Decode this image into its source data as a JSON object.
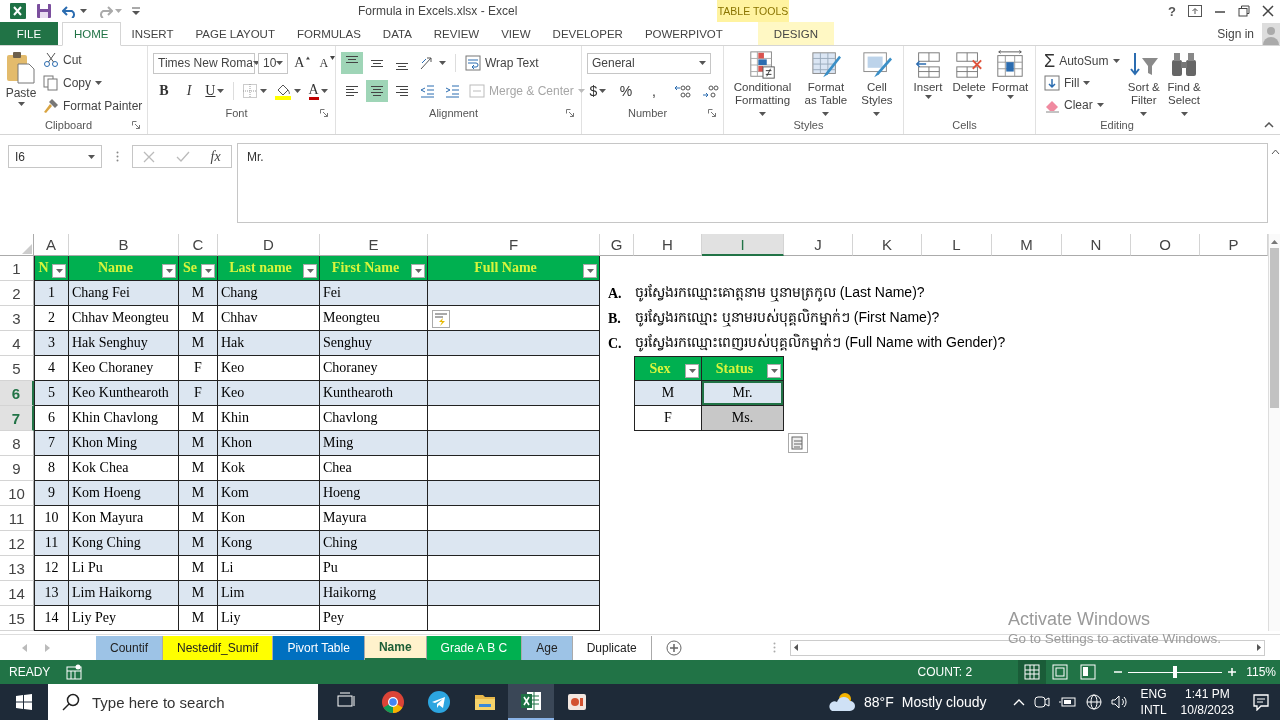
{
  "window": {
    "title": "Formula in Excels.xlsx - Excel",
    "context_label": "TABLE TOOLS",
    "help": "?",
    "sign_in": "Sign in"
  },
  "ribbon_tabs": [
    {
      "label": "FILE",
      "kind": "file",
      "selected": false
    },
    {
      "label": "HOME",
      "kind": "tab",
      "selected": true
    },
    {
      "label": "INSERT",
      "kind": "tab",
      "selected": false
    },
    {
      "label": "PAGE LAYOUT",
      "kind": "tab",
      "selected": false
    },
    {
      "label": "FORMULAS",
      "kind": "tab",
      "selected": false
    },
    {
      "label": "DATA",
      "kind": "tab",
      "selected": false
    },
    {
      "label": "REVIEW",
      "kind": "tab",
      "selected": false
    },
    {
      "label": "VIEW",
      "kind": "tab",
      "selected": false
    },
    {
      "label": "DEVELOPER",
      "kind": "tab",
      "selected": false
    },
    {
      "label": "POWERPIVOT",
      "kind": "tab",
      "selected": false
    },
    {
      "label": "DESIGN",
      "kind": "contextual",
      "selected": false
    }
  ],
  "ribbon": {
    "clipboard": {
      "label": "Clipboard",
      "paste": "Paste",
      "cut": "Cut",
      "copy": "Copy",
      "format_painter": "Format Painter"
    },
    "font": {
      "label": "Font",
      "name": "Times New Roma",
      "size": "10",
      "grow": "A",
      "shrink": "A",
      "bold": "B",
      "italic": "I",
      "underline": "U",
      "color_glyph": "A"
    },
    "alignment": {
      "label": "Alignment",
      "wrap_text": "Wrap Text",
      "merge_center": "Merge & Center",
      "merge_disabled": true,
      "buttons": [
        {
          "kind": "top",
          "selected": true
        },
        {
          "kind": "middle",
          "selected": false
        },
        {
          "kind": "bottom",
          "selected": false
        },
        {
          "kind": "left",
          "selected": false
        },
        {
          "kind": "center",
          "selected": true
        },
        {
          "kind": "right",
          "selected": false
        }
      ]
    },
    "number": {
      "label": "Number",
      "format": "General",
      "currency": "$",
      "percent": "%",
      "comma": ","
    },
    "styles": {
      "label": "Styles",
      "buttons": [
        {
          "kind": "conditional",
          "label": "Conditional Formatting"
        },
        {
          "kind": "table",
          "label": "Format as Table"
        },
        {
          "kind": "cell",
          "label": "Cell Styles"
        }
      ]
    },
    "cells": {
      "label": "Cells",
      "buttons": [
        {
          "kind": "insert",
          "label": "Insert"
        },
        {
          "kind": "delete",
          "label": "Delete"
        },
        {
          "kind": "format",
          "label": "Format"
        }
      ]
    },
    "editing": {
      "label": "Editing",
      "sum_glyph": "Σ",
      "autosum": "AutoSum",
      "fill": "Fill",
      "clear": "Clear",
      "sort_filter": "Sort & Filter",
      "find_select": "Find & Select"
    }
  },
  "formula_bar": {
    "name_box": "I6",
    "fx": "fx",
    "formula": "Mr."
  },
  "sheet": {
    "columns": [
      {
        "label": "A",
        "selected": false
      },
      {
        "label": "B",
        "selected": false
      },
      {
        "label": "C",
        "selected": false
      },
      {
        "label": "D",
        "selected": false
      },
      {
        "label": "E",
        "selected": false
      },
      {
        "label": "F",
        "selected": false
      },
      {
        "label": "G",
        "selected": false
      },
      {
        "label": "H",
        "selected": false
      },
      {
        "label": "I",
        "selected": true
      },
      {
        "label": "J",
        "selected": false
      },
      {
        "label": "K",
        "selected": false
      },
      {
        "label": "L",
        "selected": false
      },
      {
        "label": "M",
        "selected": false
      },
      {
        "label": "N",
        "selected": false
      },
      {
        "label": "O",
        "selected": false
      },
      {
        "label": "P",
        "selected": false
      }
    ],
    "rows": [
      {
        "label": "1",
        "selected": false
      },
      {
        "label": "2",
        "selected": false
      },
      {
        "label": "3",
        "selected": false
      },
      {
        "label": "4",
        "selected": false
      },
      {
        "label": "5",
        "selected": false
      },
      {
        "label": "6",
        "selected": true
      },
      {
        "label": "7",
        "selected": true
      },
      {
        "label": "8",
        "selected": false
      },
      {
        "label": "9",
        "selected": false
      },
      {
        "label": "10",
        "selected": false
      },
      {
        "label": "11",
        "selected": false
      },
      {
        "label": "12",
        "selected": false
      },
      {
        "label": "13",
        "selected": false
      },
      {
        "label": "14",
        "selected": false
      },
      {
        "label": "15",
        "selected": false
      }
    ],
    "table": {
      "headers": [
        "N",
        "Name",
        "Se",
        "Last name",
        "First Name",
        "Full Name"
      ],
      "rows": [
        {
          "no": "1",
          "name": "Chang Fei",
          "sex": "M",
          "last": "Chang",
          "first": "Fei"
        },
        {
          "no": "2",
          "name": "Chhav Meongteu",
          "sex": "M",
          "last": "Chhav",
          "first": "Meongteu"
        },
        {
          "no": "3",
          "name": "Hak Senghuy",
          "sex": "M",
          "last": "Hak",
          "first": "Senghuy"
        },
        {
          "no": "4",
          "name": "Keo Choraney",
          "sex": "F",
          "last": "Keo",
          "first": "Choraney"
        },
        {
          "no": "5",
          "name": "Keo Kunthearoth",
          "sex": "F",
          "last": "Keo",
          "first": "Kunthearoth"
        },
        {
          "no": "6",
          "name": "Khin Chavlong",
          "sex": "M",
          "last": "Khin",
          "first": "Chavlong"
        },
        {
          "no": "7",
          "name": "Khon Ming",
          "sex": "M",
          "last": "Khon",
          "first": "Ming"
        },
        {
          "no": "8",
          "name": "Kok Chea",
          "sex": "M",
          "last": "Kok",
          "first": "Chea"
        },
        {
          "no": "9",
          "name": "Kom Hoeng",
          "sex": "M",
          "last": "Kom",
          "first": "Hoeng"
        },
        {
          "no": "10",
          "name": "Kon Mayura",
          "sex": "M",
          "last": "Kon",
          "first": "Mayura"
        },
        {
          "no": "11",
          "name": "Kong Ching",
          "sex": "M",
          "last": "Kong",
          "first": "Ching"
        },
        {
          "no": "12",
          "name": "Li Pu",
          "sex": "M",
          "last": "Li",
          "first": "Pu"
        },
        {
          "no": "13",
          "name": "Lim Haikorng",
          "sex": "M",
          "last": "Lim",
          "first": "Haikorng"
        },
        {
          "no": "14",
          "name": "Liy Pey",
          "sex": "M",
          "last": "Liy",
          "first": "Pey"
        }
      ]
    },
    "questions": [
      {
        "letter": "A.",
        "text": "ចូរស្វែងរកឈ្មោះគោត្តនាម ឬនាមត្រកូល (Last Name)?"
      },
      {
        "letter": "B.",
        "text": "ចូរស្វែងរកឈ្មោះ ឬនាមរបស់បុគ្គលិកម្នាក់ៗ (First Name)?"
      },
      {
        "letter": "C.",
        "text": "ចូរស្វែងរកឈ្មោះពេញរបស់បុគ្គលិកម្នាក់ៗ (Full Name with Gender)?"
      }
    ],
    "lookup": {
      "headers": [
        "Sex",
        "Status"
      ],
      "rows": [
        {
          "sex": "M",
          "status": "Mr.",
          "active": true,
          "highlighted": false
        },
        {
          "sex": "F",
          "status": "Ms.",
          "active": false,
          "highlighted": true
        }
      ]
    }
  },
  "sheet_tabs": [
    {
      "label": "Countif",
      "color": "#9dc3e6",
      "selected": false
    },
    {
      "label": "Nestedif_Sumif",
      "color": "#ffff00",
      "selected": false
    },
    {
      "label": "Pivort Table",
      "color": "#0070c0",
      "selected": false
    },
    {
      "label": "Name",
      "color": "#fff2cc",
      "selected": true
    },
    {
      "label": "Grade A B C",
      "color": "#00b050",
      "selected": false
    },
    {
      "label": "Age",
      "color": "#9dc3e6",
      "selected": false
    },
    {
      "label": "Duplicate",
      "selected": false
    }
  ],
  "status_bar": {
    "mode": "READY",
    "count": "COUNT: 2",
    "views": [
      {
        "kind": "normal",
        "selected": true
      },
      {
        "kind": "page_layout",
        "selected": false
      },
      {
        "kind": "page_break",
        "selected": false
      }
    ],
    "zoom_slider": {
      "level": 0.5
    },
    "zoom": "115%"
  },
  "taskbar": {
    "search_placeholder": "Type here to search",
    "apps": [
      {
        "kind": "task_view",
        "active": false
      },
      {
        "kind": "chrome",
        "active": false
      },
      {
        "kind": "telegram",
        "active": false
      },
      {
        "kind": "explorer",
        "active": false
      },
      {
        "kind": "excel",
        "active": true
      },
      {
        "kind": "slides",
        "active": false
      }
    ],
    "temperature": "88°F",
    "weather": "Mostly cloudy",
    "language": "ENG",
    "layout": "INTL",
    "time": "1:41 PM",
    "date": "10/8/2023"
  },
  "activation_notice": {
    "title": "Activate Windows",
    "hint": "Go to Settings to activate Windows."
  }
}
